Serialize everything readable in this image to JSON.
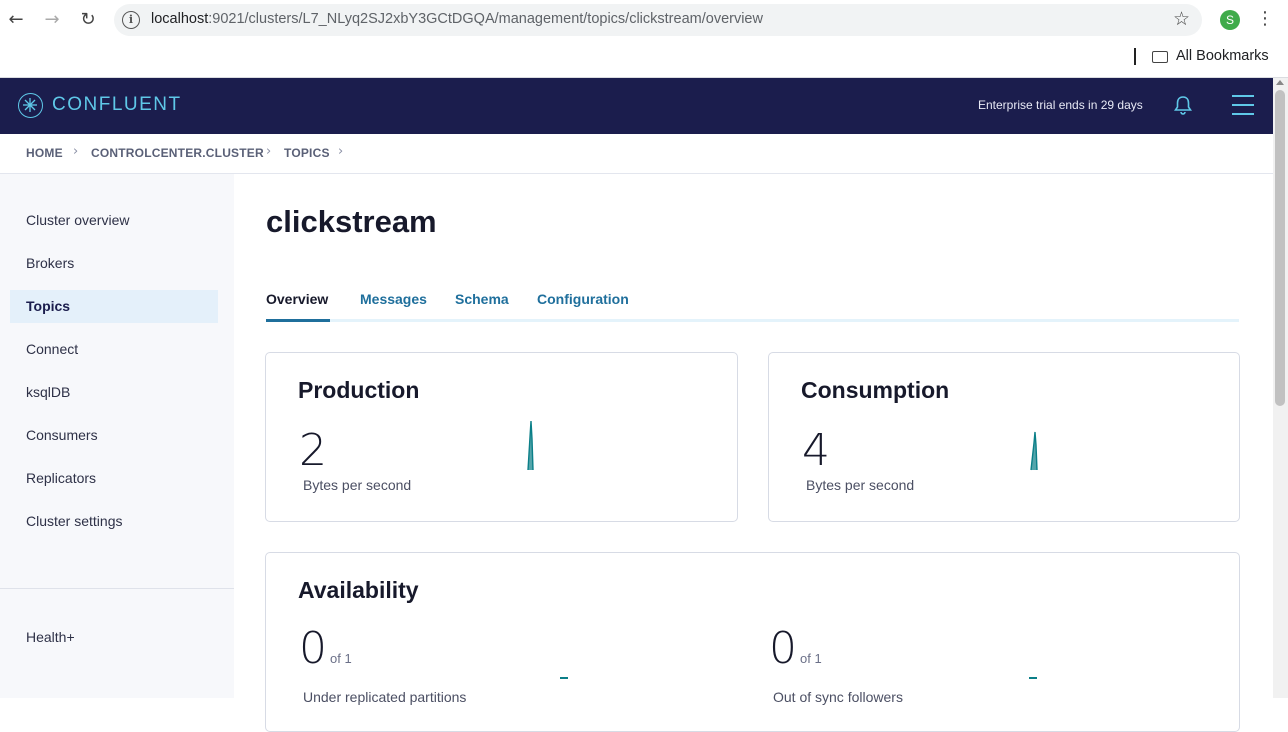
{
  "browser": {
    "url_host": "localhost",
    "url_rest": ":9021/clusters/L7_NLyq2SJ2xbY3GCtDGQA/management/topics/clickstream/overview",
    "profile_initial": "S",
    "bookmarks_label": "All Bookmarks"
  },
  "header": {
    "logo_text": "CONFLUENT",
    "trial_text": "Enterprise trial ends in 29 days",
    "accent_color": "#5fc8e8",
    "bg_color": "#1b1d4d"
  },
  "breadcrumb": {
    "items": [
      "HOME",
      "CONTROLCENTER.CLUSTER",
      "TOPICS"
    ]
  },
  "sidebar": {
    "items": [
      {
        "label": "Cluster overview"
      },
      {
        "label": "Brokers"
      },
      {
        "label": "Topics",
        "active": true
      },
      {
        "label": "Connect"
      },
      {
        "label": "ksqlDB"
      },
      {
        "label": "Consumers"
      },
      {
        "label": "Replicators"
      },
      {
        "label": "Cluster settings"
      }
    ],
    "footer_item": "Health+"
  },
  "main": {
    "topic_name": "clickstream",
    "tabs": [
      {
        "label": "Overview",
        "active": true
      },
      {
        "label": "Messages"
      },
      {
        "label": "Schema"
      },
      {
        "label": "Configuration"
      }
    ],
    "production": {
      "title": "Production",
      "value": "2",
      "unit": "Bytes per second"
    },
    "consumption": {
      "title": "Consumption",
      "value": "4",
      "unit": "Bytes per second"
    },
    "availability": {
      "title": "Availability",
      "under_replicated": {
        "value": "0",
        "of": "of 1",
        "label": "Under replicated partitions"
      },
      "out_of_sync": {
        "value": "0",
        "of": "of 1",
        "label": "Out of sync followers"
      }
    }
  }
}
